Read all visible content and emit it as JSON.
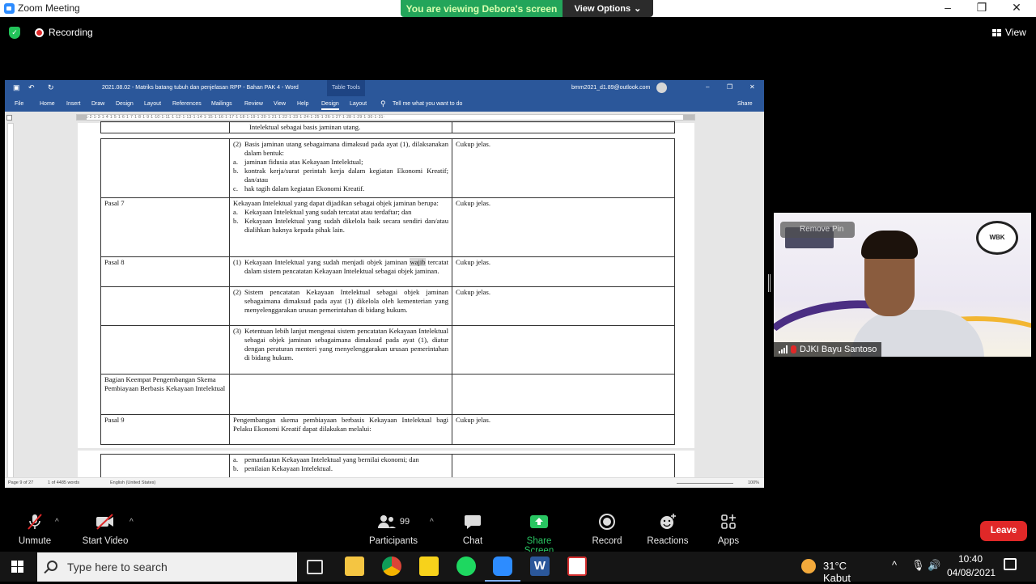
{
  "app": {
    "title": "Zoom Meeting"
  },
  "banner": {
    "viewing": "You are viewing Debora's screen",
    "view_options": "View Options"
  },
  "status": {
    "recording": "Recording",
    "view": "View"
  },
  "word": {
    "title": "2021.08.02 - Matriks batang tubuh dan penjelasan RPP - Bahan PAK 4  -  Word",
    "table_tools": "Table Tools",
    "account": "bmm2021_d1.89@outlook.com",
    "ribbon": [
      "File",
      "Home",
      "Insert",
      "Draw",
      "Design",
      "Layout",
      "References",
      "Mailings",
      "Review",
      "View",
      "Help",
      "Design",
      "Layout"
    ],
    "tell_me": "Tell me what you want to do",
    "share": "Share",
    "status_bar": {
      "page": "Page 9 of 27",
      "words": "1 of 4485 words",
      "language": "English (United States)",
      "zoom": "100%"
    },
    "ruler_text": "·1·|·1·2·1·3·1·4·1·5·1·6·1·7·1·8·1·9·1·10·1·11·1·12·1·13·1·14·1·15·1·16·1·17·1·18·1·19·1·20·1·21·1·22·1·23·1·24·1·25·1·26·1·27·1·28·1·29·1·30·1·31·"
  },
  "doc": {
    "top_fragment": "Intelektual sebagai basis jaminan utang.",
    "row1": {
      "num": "(2)",
      "intro": "Basis jaminan utang sebagaimana dimaksud pada ayat (1), dilaksanakan dalam bentuk:",
      "items": [
        {
          "n": "a.",
          "t": "jaminan fidusia atas Kekayaan Intelektual;"
        },
        {
          "n": "b.",
          "t": "kontrak kerja/surat perintah kerja dalam kegiatan Ekonomi Kreatif; dan/atau"
        },
        {
          "n": "c.",
          "t": "hak tagih dalam kegiatan Ekonomi Kreatif."
        }
      ],
      "note": "Cukup jelas."
    },
    "pasal7": {
      "label": "Pasal 7",
      "intro": "Kekayaan Intelektual yang dapat dijadikan sebagai objek jaminan berupa:",
      "items": [
        {
          "n": "a.",
          "t": "Kekayaan Intelektual yang sudah tercatat atau terdaftar; dan"
        },
        {
          "n": "b.",
          "t": "Kekayaan Intelektual yang sudah dikelola baik secara sendiri dan/atau dialihkan haknya kepada pihak lain."
        }
      ],
      "note": "Cukup jelas."
    },
    "pasal8": {
      "label": "Pasal 8",
      "a1_num": "(1)",
      "a1_pre": "Kekayaan Intelektual yang sudah menjadi objek jaminan",
      "a1_hl": "wajib",
      "a1_post": "tercatat dalam sistem pencatatan Kekayaan Intelektual sebagai objek jaminan.",
      "a1_note": "Cukup jelas.",
      "a2_num": "(2)",
      "a2": "Sistem pencatatan Kekayaan Intelektual sebagai objek jaminan sebagaimana dimaksud pada ayat (1) dikelola oleh kementerian yang menyelenggarakan urusan pemerintahan di bidang hukum.",
      "a2_note": "Cukup jelas.",
      "a3_num": "(3)",
      "a3": "Ketentuan lebih lanjut mengenai sistem pencatatan Kekayaan Intelektual sebagai objek jaminan sebagaimana dimaksud pada ayat (1), diatur dengan peraturan menteri yang menyelenggarakan urusan pemerintahan di bidang hukum."
    },
    "bagian4": "Bagian Keempat Pengembangan Skema Pembiayaan Berbasis Kekayaan Intelektual",
    "pasal9": {
      "label": "Pasal 9",
      "text": "Pengembangan skema pembiayaan berbasis Kekayaan Intelektual bagi Pelaku Ekonomi Kreatif dapat dilakukan melalui:",
      "note": "Cukup jelas."
    },
    "page2_items": [
      {
        "n": "a.",
        "t": "pemanfaatan Kekayaan Intelektual yang bernilai ekonomi; dan"
      },
      {
        "n": "b.",
        "t": "penilaian Kekayaan Intelektual."
      }
    ]
  },
  "video": {
    "remove_pin": "Remove Pin",
    "name": "DJKI Bayu Santoso",
    "logo_text": "WBK"
  },
  "toolbar": {
    "unmute": "Unmute",
    "start_video": "Start Video",
    "participants": "Participants",
    "participants_count": "99",
    "chat": "Chat",
    "share_screen": "Share Screen",
    "record": "Record",
    "reactions": "Reactions",
    "apps": "Apps",
    "leave": "Leave"
  },
  "taskbar": {
    "search_placeholder": "Type here to search",
    "weather": "31°C  Kabut",
    "time": "10:40",
    "date": "04/08/2021"
  },
  "colors": {
    "zoom_green": "#23a55a",
    "word_blue": "#2b579a",
    "leave_red": "#e02828",
    "share_green": "#29c562"
  },
  "icons": [
    "zoom-icon",
    "shield-icon",
    "record-icon",
    "view-grid-icon",
    "microphone-muted-icon",
    "camera-muted-icon",
    "participants-icon",
    "chat-icon",
    "share-screen-icon",
    "record-button-icon",
    "reactions-icon",
    "apps-icon",
    "windows-icon",
    "search-icon",
    "file-explorer-icon",
    "chrome-icon",
    "sticky-notes-icon",
    "spotify-icon",
    "zoom-app-icon",
    "word-app-icon",
    "pdf-app-icon",
    "weather-icon",
    "speaker-icon",
    "notification-icon"
  ]
}
